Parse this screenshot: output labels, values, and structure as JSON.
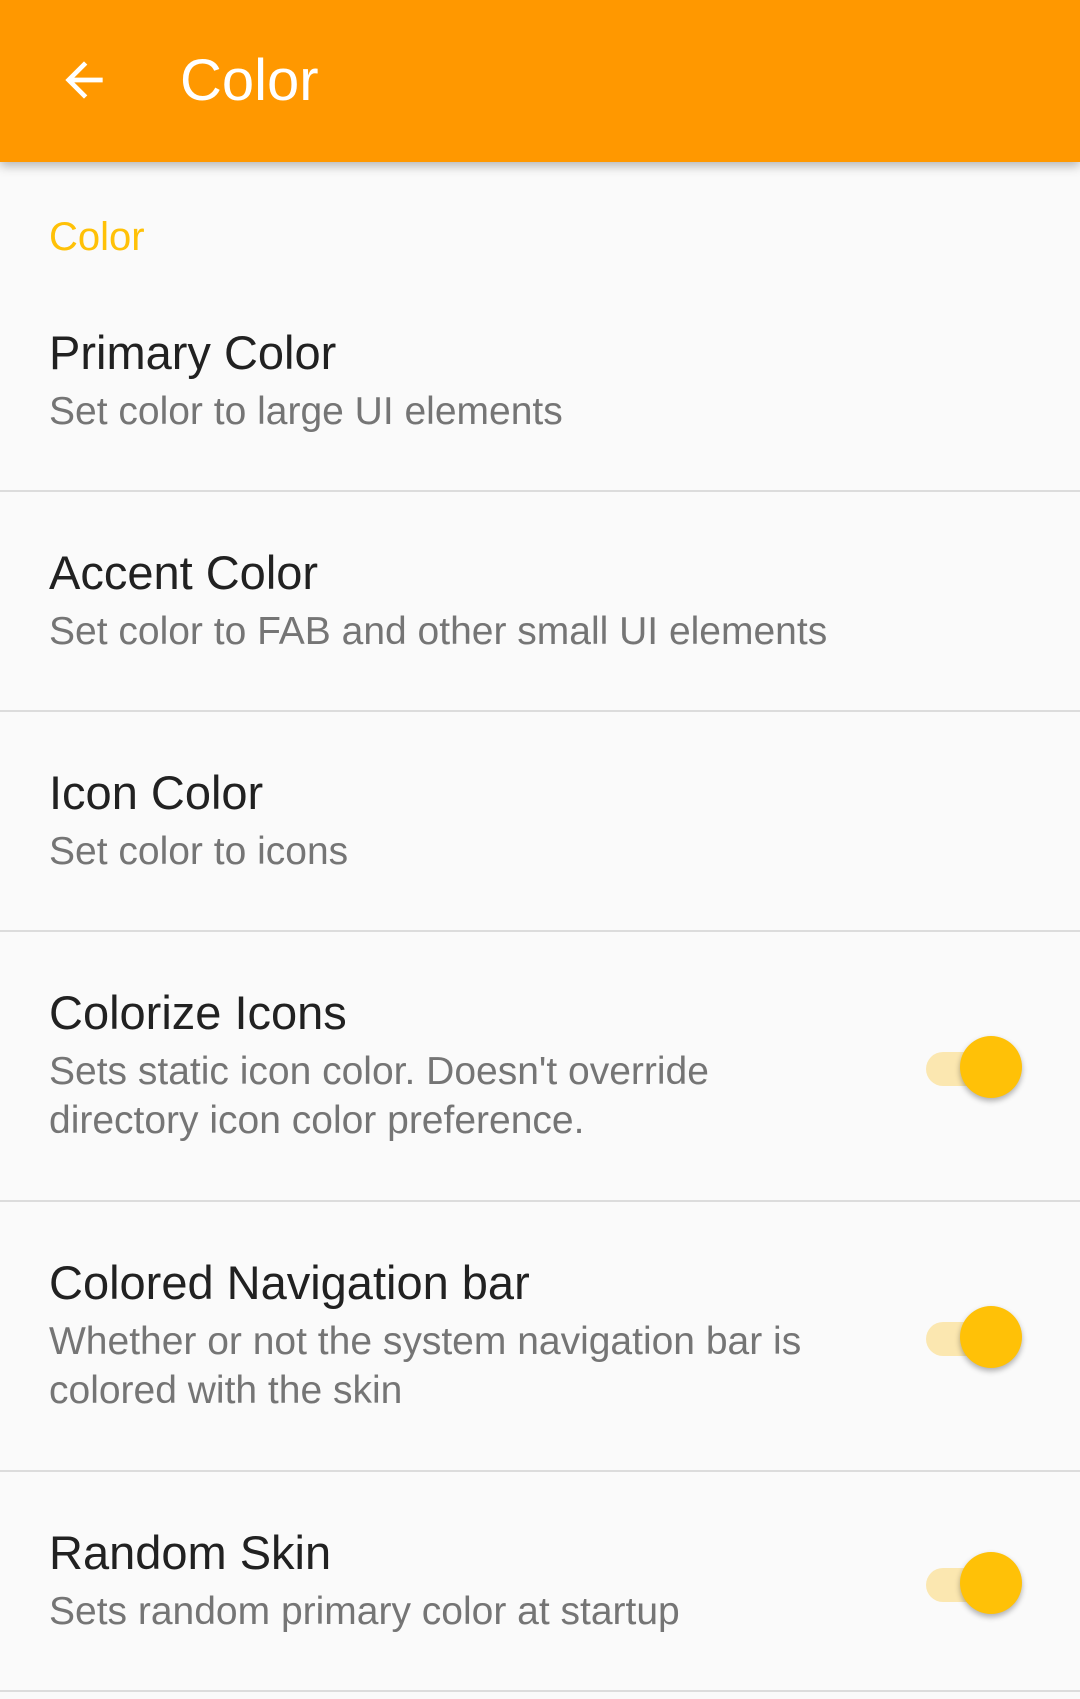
{
  "app_bar": {
    "title": "Color",
    "back_icon": "arrow-left-icon",
    "color": "#ff9800"
  },
  "section": {
    "header": "Color",
    "header_color": "#ffc107"
  },
  "preferences": [
    {
      "title": "Primary Color",
      "summary": "Set color to large UI elements"
    },
    {
      "title": "Accent Color",
      "summary": "Set color to FAB and other small UI elements"
    },
    {
      "title": "Icon Color",
      "summary": "Set color to icons"
    },
    {
      "title": "Colorize Icons",
      "summary": "Sets static icon color. Doesn't override directory icon color preference.",
      "switch_on": true
    },
    {
      "title": "Colored Navigation bar",
      "summary": "Whether or not the system navigation bar is colored with the skin",
      "switch_on": true
    },
    {
      "title": "Random Skin",
      "summary": "Sets random primary color at startup",
      "switch_on": true
    }
  ],
  "switch_colors": {
    "thumb": "#ffc107",
    "track": "#fbe7b0"
  }
}
